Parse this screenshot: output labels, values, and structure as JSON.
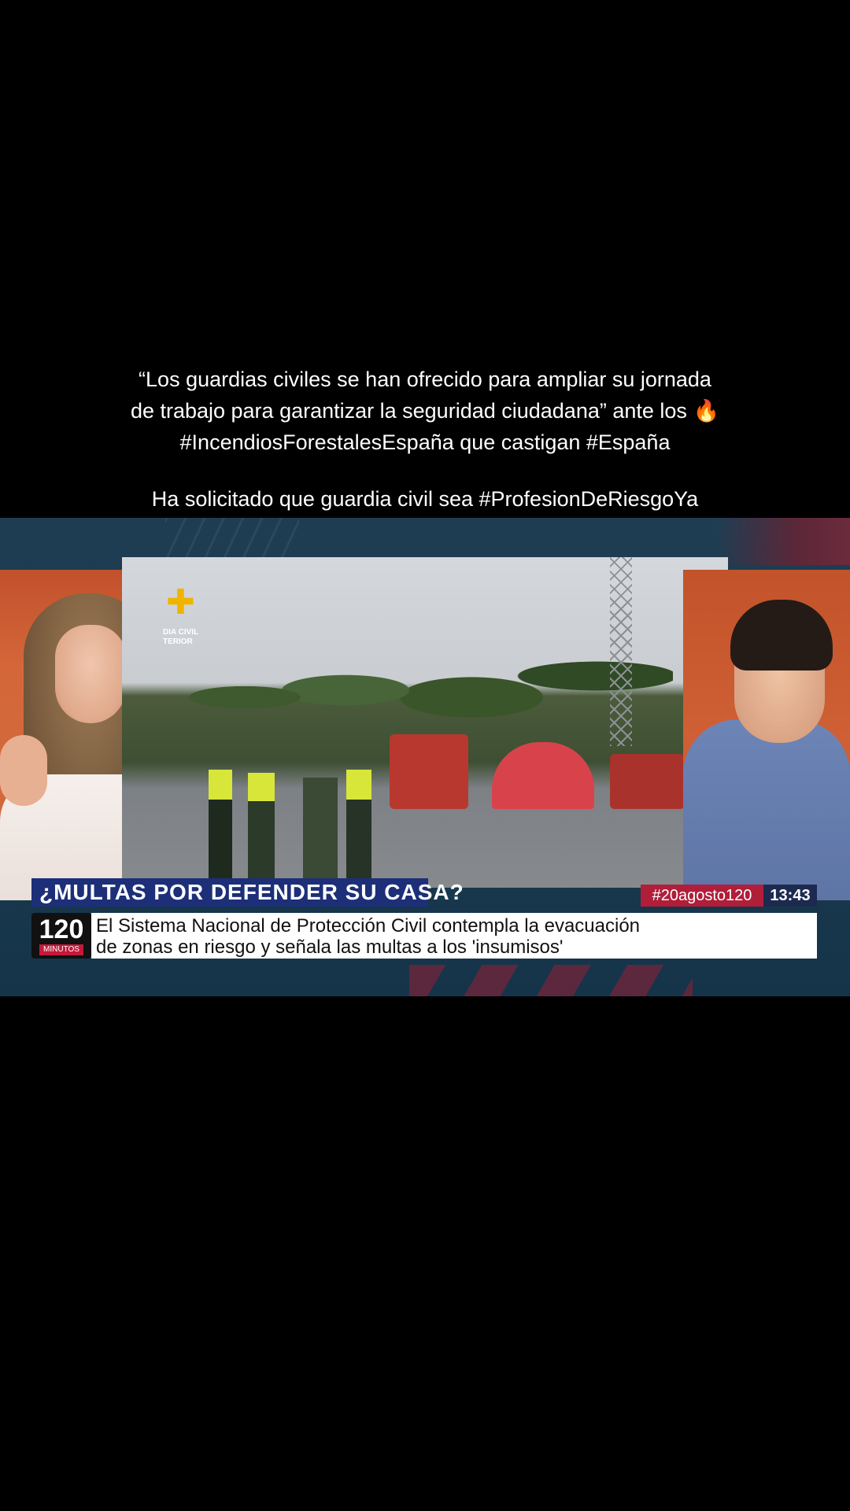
{
  "caption": {
    "line1": "“Los guardias civiles se han ofrecido para ampliar su jornada",
    "line2": "de trabajo para garantizar la seguridad ciudadana” ante los",
    "line2_emoji": "🔥",
    "line3": "#IncendiosForestalesEspaña que castigan  #España",
    "line4": "Ha solicitado que  guardia civil sea #ProfesionDeRiesgoYa"
  },
  "video": {
    "headline": "¿MULTAS POR DEFENDER SU CASA?",
    "hashtag": "#20agosto120",
    "clock": "13:43",
    "channel_logo_number": "120",
    "channel_logo_word": "MINUTOS",
    "ticker_line1": "El Sistema Nacional de Protección Civil contempla la evacuación",
    "ticker_line2": "de zonas en riesgo y señala las multas a los 'insumisos'",
    "footage_logo_text_1": "DIA CIVIL",
    "footage_logo_text_2": "TERIOR"
  },
  "colors": {
    "background": "#000000",
    "headline_bar": "#1c2f78",
    "hashtag_bar": "#b01e3a",
    "studio_orange": "#c2532a"
  }
}
